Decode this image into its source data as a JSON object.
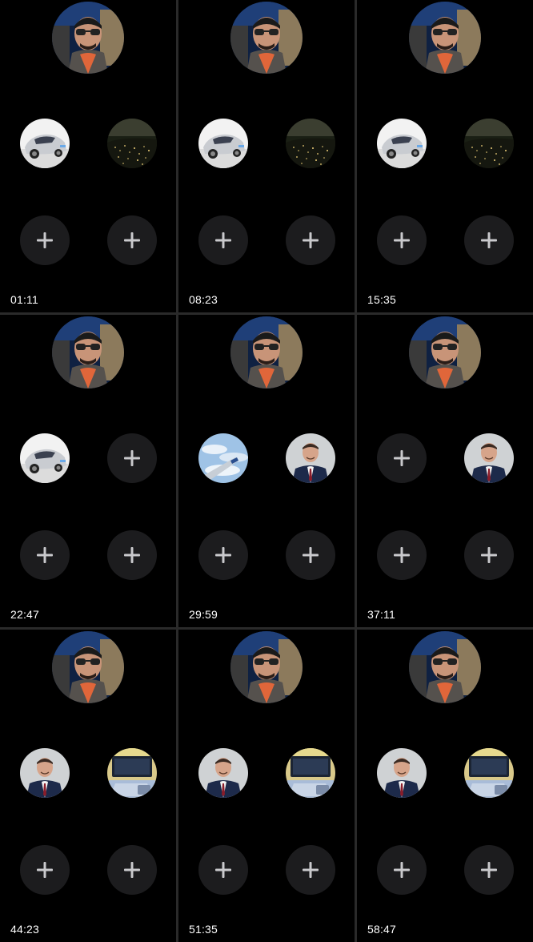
{
  "frames": [
    {
      "time": "01:11",
      "left": "car",
      "right": "night-city"
    },
    {
      "time": "08:23",
      "left": "car",
      "right": "night-city"
    },
    {
      "time": "15:35",
      "left": "car",
      "right": "night-city"
    },
    {
      "time": "22:47",
      "left": "car",
      "right": "add"
    },
    {
      "time": "29:59",
      "left": "airplane-wing",
      "right": "man-suit"
    },
    {
      "time": "37:11",
      "left": "add",
      "right": "man-suit"
    },
    {
      "time": "44:23",
      "left": "man-suit",
      "right": "laptop-desk"
    },
    {
      "time": "51:35",
      "left": "man-suit",
      "right": "laptop-desk"
    },
    {
      "time": "58:47",
      "left": "man-suit",
      "right": "laptop-desk"
    }
  ],
  "colors": {
    "background": "#000000",
    "add_button": "#1c1c1e",
    "plus_glyph": "#c9c9cc",
    "divider": "#2a2a2a",
    "timestamp_text": "#ffffff"
  },
  "icons": {
    "add": "plus-icon"
  }
}
